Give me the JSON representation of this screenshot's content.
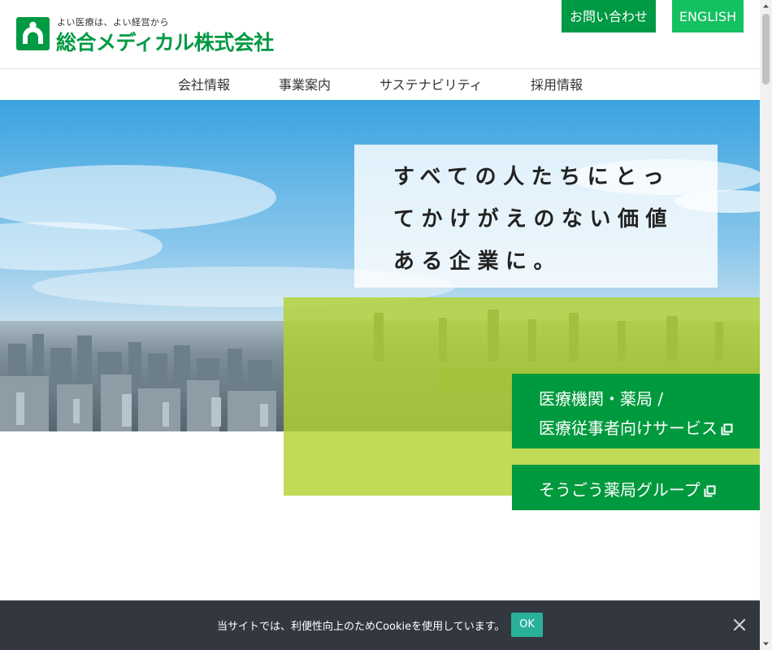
{
  "header": {
    "tagline": "よい医療は、よい経営から",
    "company_name": "総合メディカル株式会社",
    "contact_label": "お問い合わせ",
    "english_label": "ENGLISH"
  },
  "nav": {
    "items": [
      {
        "label": "会社情報"
      },
      {
        "label": "事業案内"
      },
      {
        "label": "サステナビリティ"
      },
      {
        "label": "採用情報"
      }
    ]
  },
  "hero": {
    "headline": "すべての人たちにとってかけがえのない価値ある企業に。",
    "cta_medical": {
      "line1": "医療機関・薬局 /",
      "line2": "医療従事者向けサービス"
    },
    "cta_group": {
      "line1": "そうごう薬局グループ"
    }
  },
  "cookie": {
    "message": "当サイトでは、利便性向上のためCookieを使用しています。",
    "ok_label": "OK"
  },
  "colors": {
    "brand_green": "#009a44",
    "light_green_button": "#14c160",
    "lime_panel": "#b3d233",
    "cookie_bar": "#333840",
    "ok_button": "#2ab09a"
  },
  "icons": [
    "logo-mark-icon",
    "external-link-icon",
    "close-icon",
    "scroll-arrow-up-icon",
    "scroll-arrow-down-icon"
  ]
}
